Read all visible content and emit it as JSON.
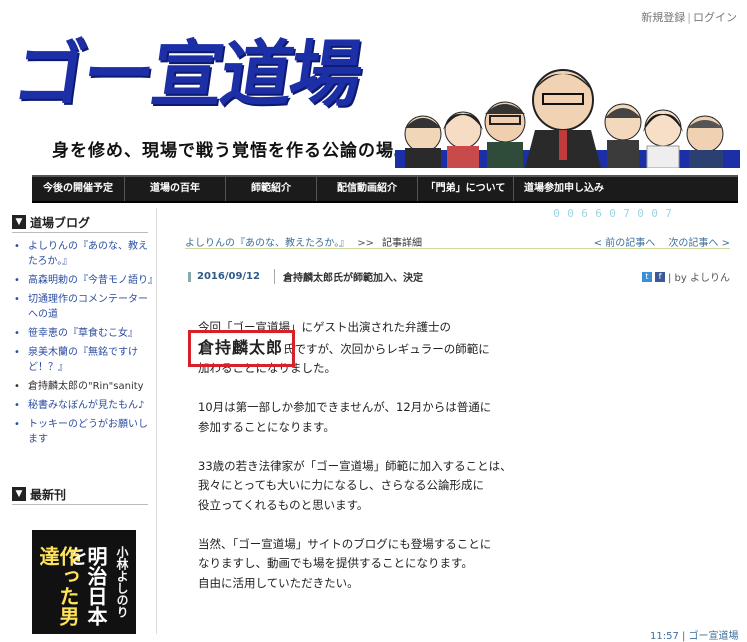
{
  "topbar": {
    "register": "新規登録",
    "separator": "|",
    "login": "ログイン"
  },
  "banner": {
    "logo_text": "ゴー宣道場",
    "tagline": "身を修め、現場で戦う覚悟を作る公論の場。"
  },
  "nav": {
    "items": [
      {
        "label": "今後の開催予定"
      },
      {
        "label": "道場の百年"
      },
      {
        "label": "師範紹介"
      },
      {
        "label": "配信動画紹介"
      },
      {
        "label": "「門弟」について"
      },
      {
        "label": "道場参加申し込み"
      }
    ]
  },
  "sidebar": {
    "blog_heading": "道場ブログ",
    "blog_items": [
      {
        "label": "よしりんの『あのな、教えたろか。』",
        "dark": false
      },
      {
        "label": "高森明勅の『今昔モノ語り』",
        "dark": false
      },
      {
        "label": "切通理作のコメンテーターへの道",
        "dark": false
      },
      {
        "label": "笹幸恵の『草食むこ女』",
        "dark": false
      },
      {
        "label": "泉美木蘭の『無銘ですけど！？』",
        "dark": false
      },
      {
        "label": "倉持麟太郎の\"Rin\"sanity",
        "dark": false
      },
      {
        "label": "秘書みなぼんが見たもん♪",
        "dark": false
      },
      {
        "label": "トッキーのどうがお願いします",
        "dark": false
      }
    ],
    "new_heading": "最新刊",
    "book": {
      "title_line1": "明治日本を",
      "title_line2": "作った男達",
      "author": "小林よしのり"
    }
  },
  "counter": {
    "digits": [
      "0",
      "0",
      "6",
      "6",
      "0",
      "7",
      "0",
      "0",
      "7"
    ]
  },
  "content": {
    "breadcrumb_blog": "よしりんの『あのな、教えたろか。』",
    "breadcrumb_sep": ">>",
    "breadcrumb_current": "記事詳細",
    "prev_link": "< 前の記事へ",
    "next_link": "次の記事へ >",
    "date": "2016/09/12",
    "post_title": "倉持麟太郎氏が師範加入、決定",
    "byline": "| by よしりん",
    "paragraphs": [
      {
        "lines": [
          "今回「ゴー宣道場」にゲスト出演された弁護士の"
        ],
        "name_line": {
          "name": "倉持麟太郎",
          "rest": "氏ですが、次回からレギュラーの師範に"
        },
        "after": [
          "加わることになりました。"
        ]
      },
      {
        "lines": [
          "10月は第一部しか参加できませんが、12月からは普通に",
          "参加することになります。"
        ]
      },
      {
        "lines": [
          "33歳の若き法律家が「ゴー宣道場」師範に加入することは、",
          "我々にとっても大いに力になるし、さらなる公論形成に",
          "役立ってくれるものと思います。"
        ]
      },
      {
        "lines": [
          "当然、「ゴー宣道場」サイトのブログにも登場することに",
          "なりますし、動画でも場を提供することになります。",
          "自由に活用していただきたい。"
        ]
      }
    ],
    "footer_time": "11:57 | ゴー宣道場"
  },
  "colors": {
    "logo": "#1c2fa6",
    "nav_bg": "#1b1b1b",
    "highlight_box": "#d6202a",
    "link": "#2b4ea0"
  }
}
